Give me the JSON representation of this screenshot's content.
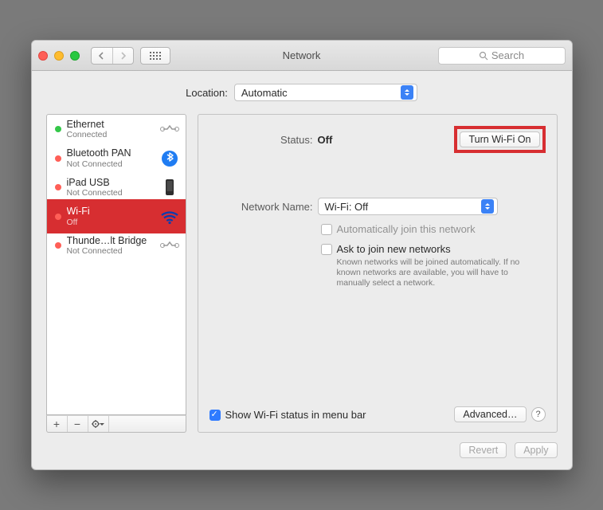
{
  "window": {
    "title": "Network"
  },
  "toolbar": {
    "search_placeholder": "Search"
  },
  "location": {
    "label": "Location:",
    "value": "Automatic"
  },
  "sidebar": {
    "items": [
      {
        "name": "Ethernet",
        "sub": "Connected",
        "dot": "green",
        "icon": "ethernet"
      },
      {
        "name": "Bluetooth PAN",
        "sub": "Not Connected",
        "dot": "red",
        "icon": "bluetooth"
      },
      {
        "name": "iPad USB",
        "sub": "Not Connected",
        "dot": "red",
        "icon": "phone"
      },
      {
        "name": "Wi-Fi",
        "sub": "Off",
        "dot": "red",
        "icon": "wifi",
        "selected": true
      },
      {
        "name": "Thunde…lt Bridge",
        "sub": "Not Connected",
        "dot": "red",
        "icon": "ethernet"
      }
    ]
  },
  "detail": {
    "status_label": "Status:",
    "status_value": "Off",
    "turn_on_label": "Turn Wi-Fi On",
    "network_name_label": "Network Name:",
    "network_name_value": "Wi-Fi: Off",
    "auto_join_label": "Automatically join this network",
    "ask_join_label": "Ask to join new networks",
    "ask_join_fine": "Known networks will be joined automatically. If no known networks are available, you will have to manually select a network.",
    "show_menubar_label": "Show Wi-Fi status in menu bar",
    "advanced_label": "Advanced…"
  },
  "footer": {
    "revert": "Revert",
    "apply": "Apply"
  }
}
